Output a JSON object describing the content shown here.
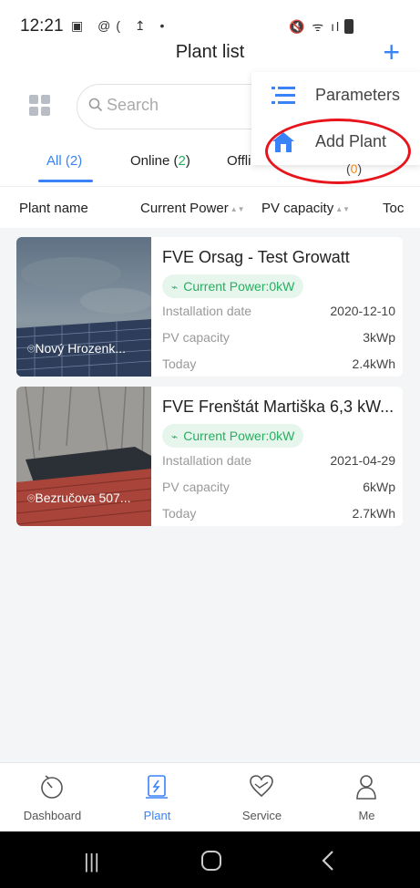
{
  "statusbar": {
    "time": "12:21",
    "left_icons": "▣ @( ↥ •",
    "right_icons": "🔇 ᯤ ıl ıl"
  },
  "header": {
    "title": "Plant list",
    "add_icon": "plus-icon"
  },
  "search": {
    "placeholder": "Search"
  },
  "tabs": [
    {
      "label": "All",
      "count": "2"
    },
    {
      "label": "Online",
      "count": "2"
    },
    {
      "label": "Offli",
      "count": "0"
    }
  ],
  "columns": [
    "Plant name",
    "Current Power",
    "PV capacity",
    "Toc"
  ],
  "plants": [
    {
      "name": "FVE Orsag - Test Growatt",
      "location": "Nový Hrozenk...",
      "current_power": "Current Power:0kW",
      "installation_label": "Installation date",
      "installation_date": "2020-12-10",
      "pv_label": "PV capacity",
      "pv_capacity": "3kWp",
      "today_label": "Today",
      "today": "2.4kWh"
    },
    {
      "name": "FVE Frenštát Martiška 6,3 kW...",
      "location": "Bezručova 507...",
      "current_power": "Current Power:0kW",
      "installation_label": "Installation date",
      "installation_date": "2021-04-29",
      "pv_label": "PV capacity",
      "pv_capacity": "6kWp",
      "today_label": "Today",
      "today": "2.7kWh"
    }
  ],
  "popup_menu": {
    "items": [
      {
        "label": "Parameters",
        "icon": "list-icon"
      },
      {
        "label": "Add Plant",
        "icon": "house-icon"
      }
    ]
  },
  "bottom_nav": [
    {
      "label": "Dashboard",
      "icon": "dashboard-icon"
    },
    {
      "label": "Plant",
      "icon": "plant-icon"
    },
    {
      "label": "Service",
      "icon": "heart-hands-icon"
    },
    {
      "label": "Me",
      "icon": "person-icon"
    }
  ],
  "colors": {
    "accent": "#3a82f7",
    "online_green": "#27ae60",
    "offline_orange": "#f08b1a",
    "highlight_red": "#e8141b"
  }
}
